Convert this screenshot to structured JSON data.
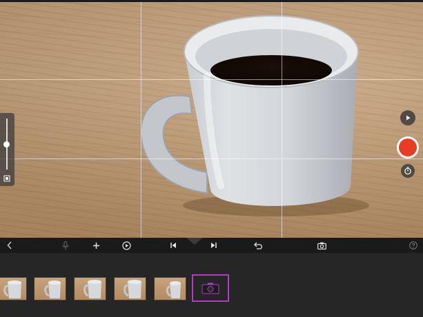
{
  "viewfinder": {
    "grid_lines": "on",
    "zoom_level": 0.5
  },
  "camera_controls": {
    "play_icon": "play-icon",
    "record_icon": "record-icon",
    "timer_icon": "timer-icon",
    "record_color": "#ea3b25"
  },
  "toolbar": {
    "items": [
      "back-icon",
      "microphone-icon",
      "plus-icon",
      "playback-speed-icon",
      "skip-back-icon",
      "skip-forward-icon",
      "undo-icon",
      "camera-icon",
      "help-icon"
    ]
  },
  "filmstrip": {
    "clip_count": 5,
    "selected_color": "#b43cc8"
  }
}
